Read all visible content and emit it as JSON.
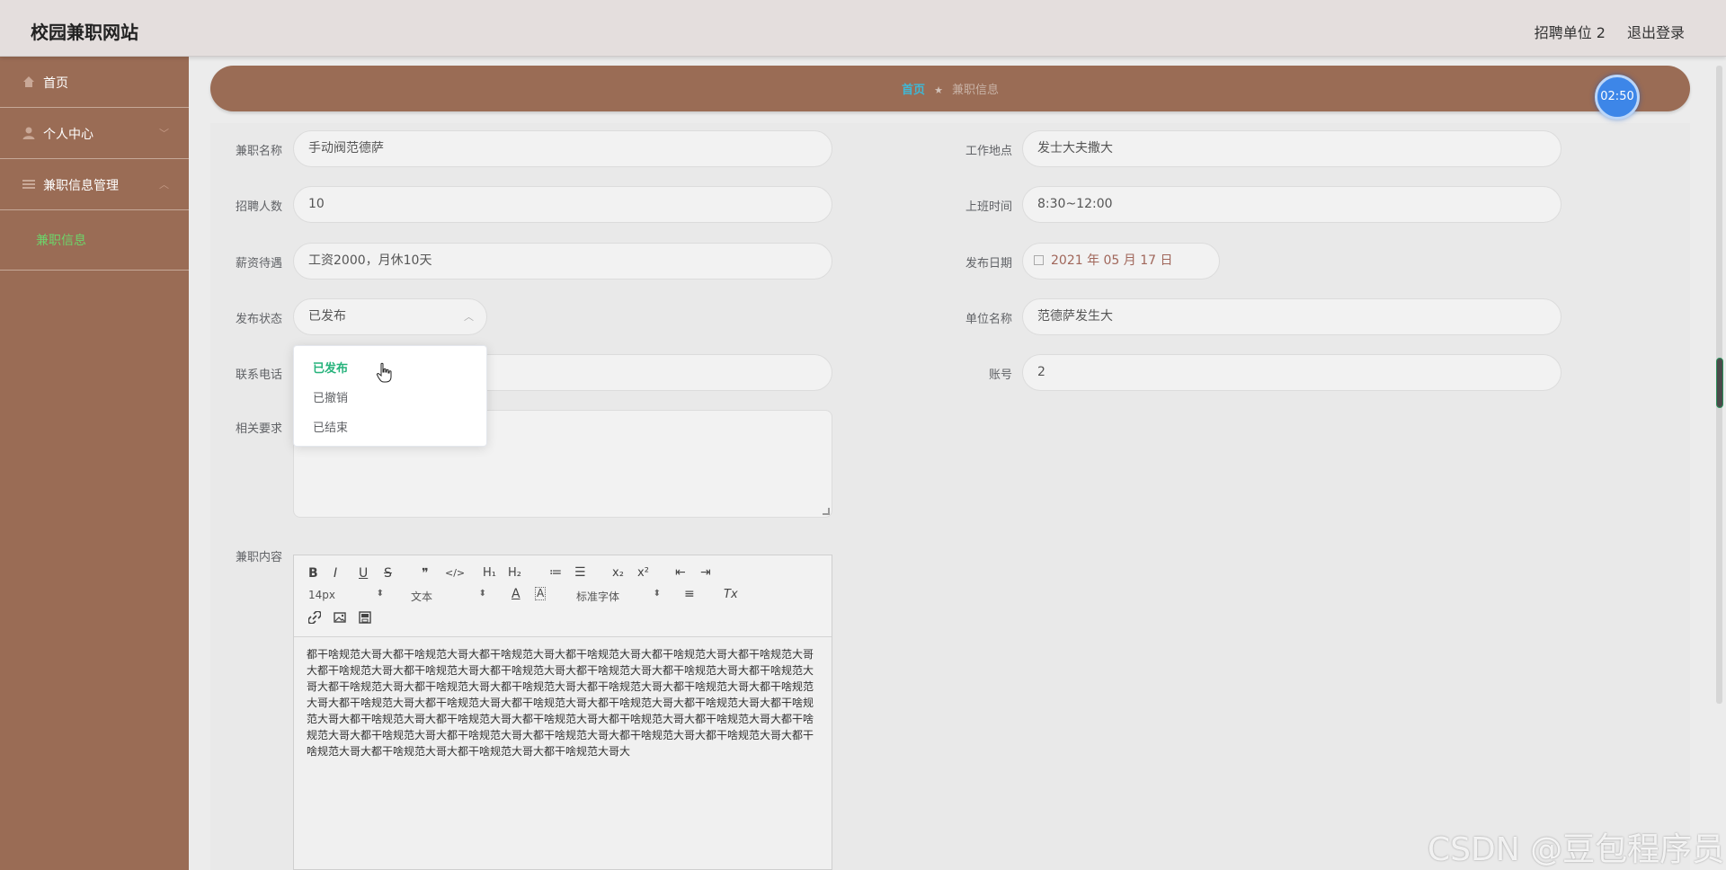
{
  "header": {
    "brand": "校园兼职网站",
    "user": "招聘单位 2",
    "logout": "退出登录"
  },
  "sidebar": {
    "items": [
      {
        "label": "首页",
        "icon": "home-icon"
      },
      {
        "label": "个人中心",
        "icon": "user-icon"
      },
      {
        "label": "兼职信息管理",
        "icon": "menu-icon"
      }
    ],
    "subitem": "兼职信息"
  },
  "breadcrumb": {
    "home": "首页",
    "separator": "★",
    "current": "兼职信息"
  },
  "timer": "02:50",
  "form": {
    "name": {
      "label": "兼职名称",
      "value": "手动阀范德萨"
    },
    "location": {
      "label": "工作地点",
      "value": "发士大夫撒大"
    },
    "headcount": {
      "label": "招聘人数",
      "value": "10"
    },
    "work_time": {
      "label": "上班时间",
      "value": "8:30~12:00"
    },
    "salary": {
      "label": "薪资待遇",
      "value": "工资2000，月休10天"
    },
    "publish_date": {
      "label": "发布日期",
      "value": "2021 年 05 月 17 日"
    },
    "publish_status": {
      "label": "发布状态",
      "value": "已发布"
    },
    "company": {
      "label": "单位名称",
      "value": "范德萨发生大"
    },
    "phone": {
      "label": "联系电话",
      "value": ""
    },
    "account": {
      "label": "账号",
      "value": "2"
    },
    "requirements": {
      "label": "相关要求",
      "value": ""
    },
    "content": {
      "label": "兼职内容"
    }
  },
  "dropdown": {
    "options": [
      "已发布",
      "已撤销",
      "已结束"
    ],
    "selected": "已发布"
  },
  "editor": {
    "toolbar": {
      "bold": "B",
      "italic": "I",
      "underline": "U",
      "strike": "S",
      "quote": "❞",
      "code": "</>",
      "h1": "H₁",
      "h2": "H₂",
      "ol": "≔",
      "ul": "☰",
      "sub": "x₂",
      "sup": "x²",
      "outdent": "⇤",
      "indent": "⇥",
      "size": "14px",
      "format": "文本",
      "font": "标准字体",
      "color": "A",
      "bg": "A",
      "align": "≡",
      "clear": "Tx"
    },
    "text": "都干啥规范大哥大都干啥规范大哥大都干啥规范大哥大都干啥规范大哥大都干啥规范大哥大都干啥规范大哥大都干啥规范大哥大都干啥规范大哥大都干啥规范大哥大都干啥规范大哥大都干啥规范大哥大都干啥规范大哥大都干啥规范大哥大都干啥规范大哥大都干啥规范大哥大都干啥规范大哥大都干啥规范大哥大都干啥规范大哥大都干啥规范大哥大都干啥规范大哥大都干啥规范大哥大都干啥规范大哥大都干啥规范大哥大都干啥规范大哥大都干啥规范大哥大都干啥规范大哥大都干啥规范大哥大都干啥规范大哥大都干啥规范大哥大都干啥规范大哥大都干啥规范大哥大都干啥规范大哥大都干啥规范大哥大都干啥规范大哥大都干啥规范大哥大都干啥规范大哥大都干啥规范大哥大都干啥规范大哥大都干啥规范大哥大"
  },
  "watermark": "CSDN @豆包程序员",
  "colors": {
    "sidebar": "#9a6c55",
    "header": "#e4dedd",
    "active_green": "#27b37c",
    "timer_blue": "#3d86e8"
  }
}
